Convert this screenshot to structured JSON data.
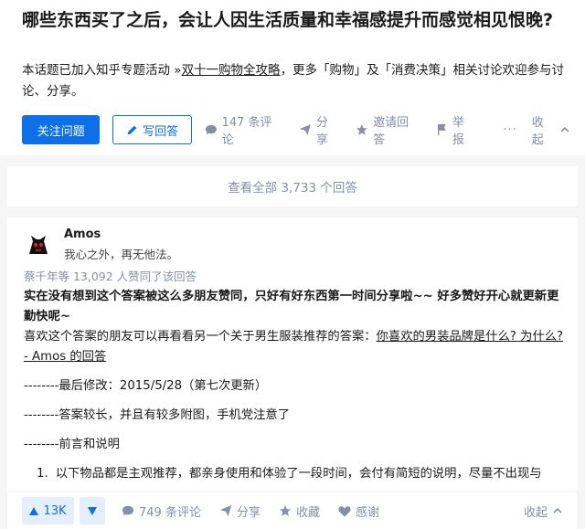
{
  "question": {
    "title": "哪些东西买了之后，会让人因生活质量和幸福感提升而感觉相见恨晚?",
    "desc_prefix": "本话题已加入知乎专题活动 »",
    "desc_link1": "双十一购物全攻略",
    "desc_middle": "，更多「购物」及「消费决策」相关讨论欢迎参与讨论、分享。",
    "follow_label": "关注问题",
    "write_label": "写回答",
    "comments_label": "147 条评论",
    "share_label": "分享",
    "invite_label": "邀请回答",
    "report_label": "举报",
    "more_label": "···",
    "collapse_label": "收起"
  },
  "view_all": "查看全部 3,733 个回答",
  "answer": {
    "author_name": "Amos",
    "author_bio": "我心之外，再无他法。",
    "voters": "蔡千年等 13,092 人赞同了该回答",
    "p1": "实在没有想到这个答案被这么多朋友赞同，只好有好东西第一时间分享啦~~ 好多赞好开心就更新更勤快呢~",
    "p2_prefix": "喜欢这个答案的朋友可以再看看另一个关于男生服装推荐的答案：",
    "p2_link": "你喜欢的男装品牌是什么? 为什么? - Amos 的回答",
    "p3": "--------最后修改：2015/5/28（第七次更新）",
    "p4": "--------答案较长，并且有较多附图，手机党注意了",
    "p5": "--------前言和说明",
    "li_num": "1.",
    "li_text": "以下物品都是主观推荐，都亲身使用和体验了一段时间，会付有简短的说明，尽量不出现与"
  },
  "bottom": {
    "upvote_count": "13K",
    "comments_label": "749 条评论",
    "share_label": "分享",
    "collect_label": "收藏",
    "thanks_label": "感谢",
    "collapse_label": "收起"
  },
  "colors": {
    "accent": "#0d70e8",
    "muted": "#8590a6"
  }
}
